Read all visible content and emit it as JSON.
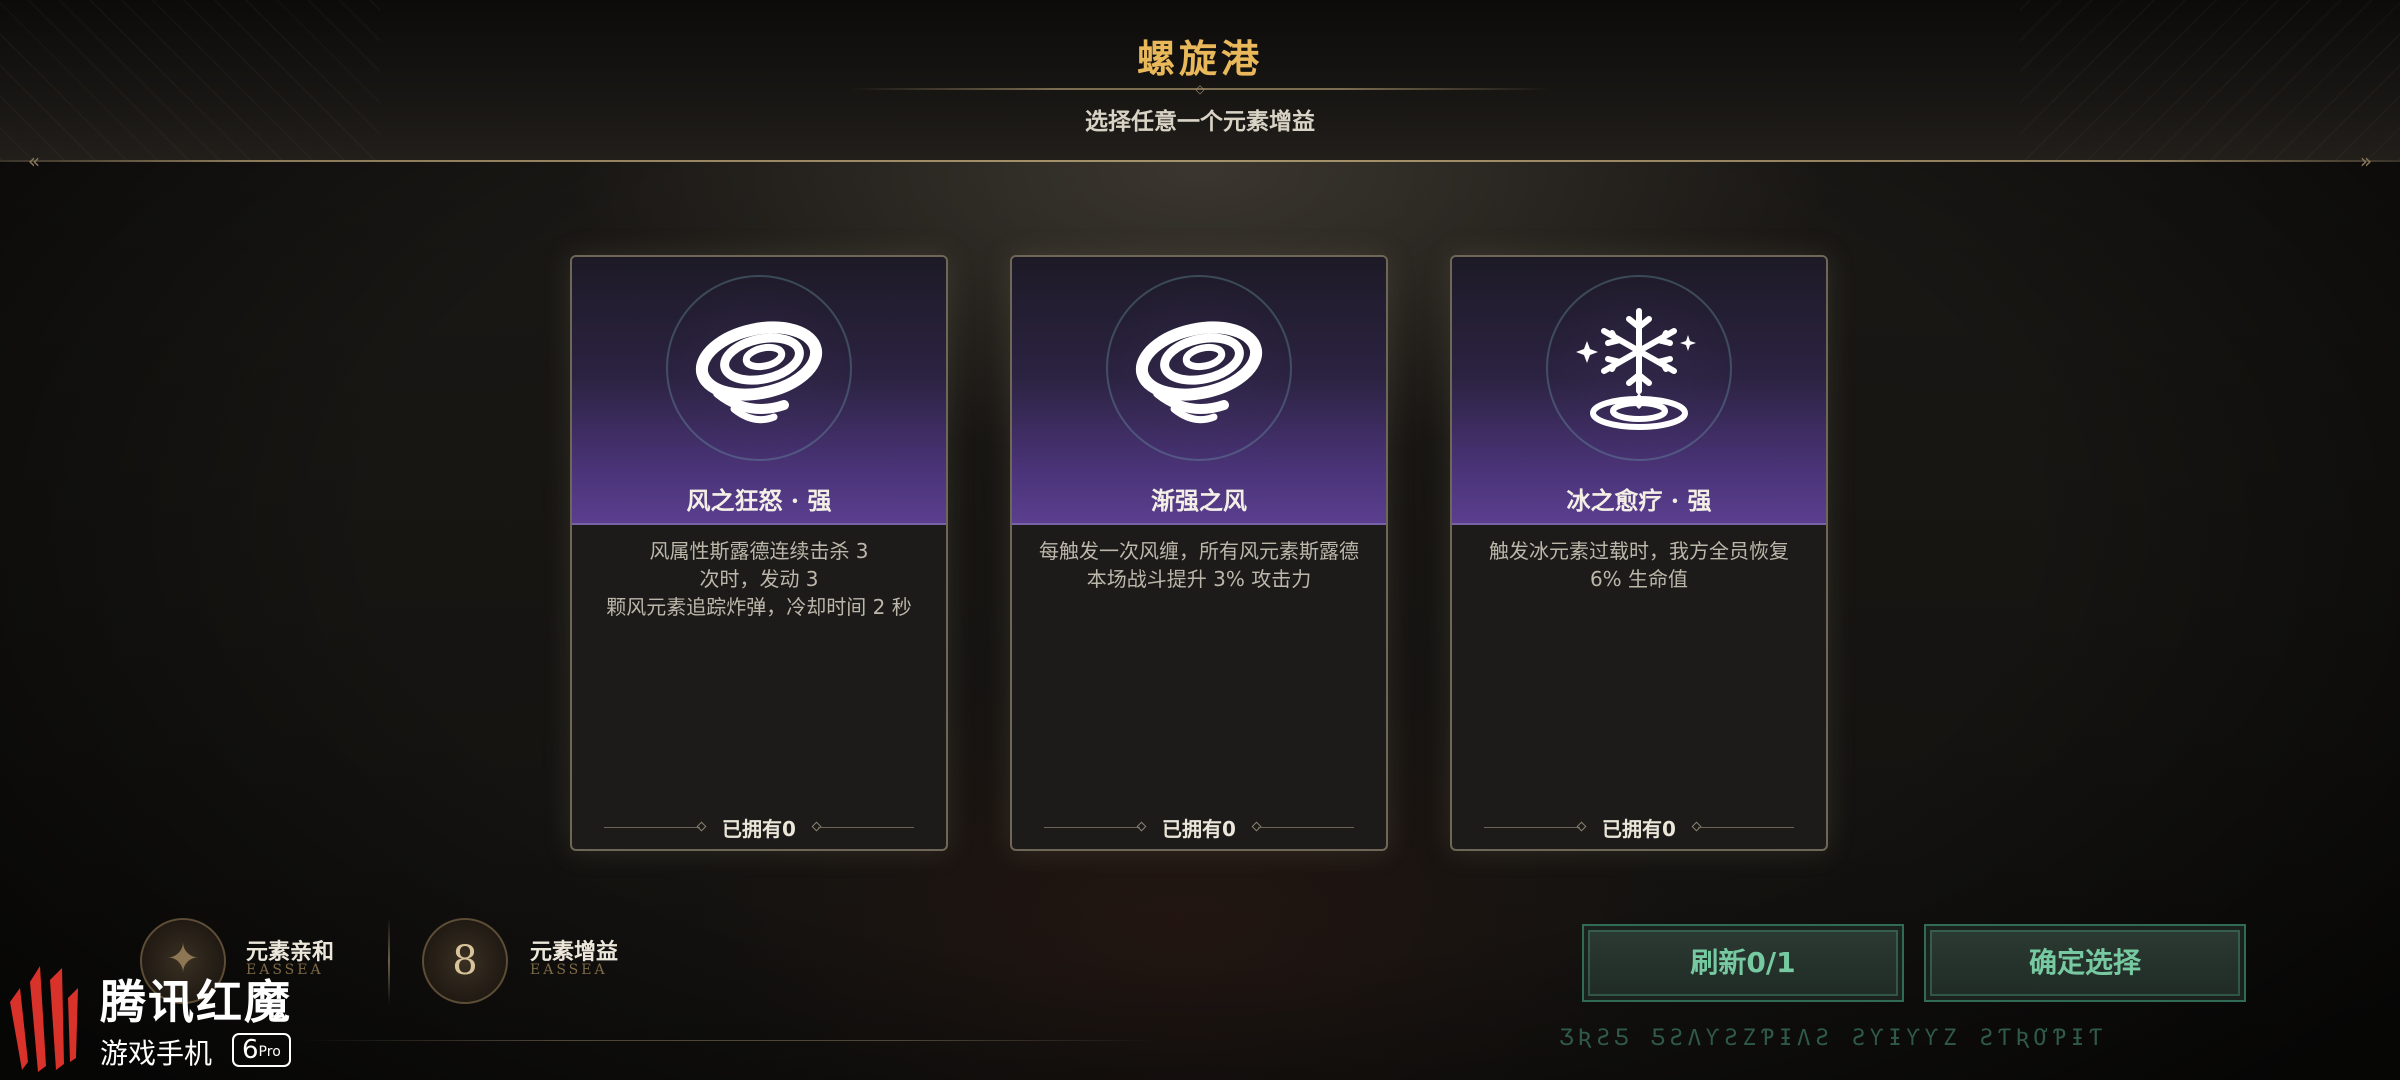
{
  "header": {
    "title": "螺旋港",
    "subtitle": "选择任意一个元素增益"
  },
  "cards": [
    {
      "name": "风之狂怒 · 强",
      "icon": "wind-vortex-icon",
      "description": "风属性斯露德连续击杀 3\n次时，发动 3\n颗风元素追踪炸弹，冷却时间 2 秒",
      "owned": "已拥有0"
    },
    {
      "name": "渐强之风",
      "icon": "wind-vortex-icon",
      "description": "每触发一次风缠，所有风元素斯露德\n本场战斗提升 3% 攻击力",
      "owned": "已拥有0"
    },
    {
      "name": "冰之愈疗 · 强",
      "icon": "snowflake-heal-icon",
      "description": "触发冰元素过载时，我方全员恢复\n6% 生命值",
      "owned": "已拥有0"
    }
  ],
  "bottom": {
    "affinity_label": "元素亲和",
    "affinity_sub": "EASSEA",
    "boost_label": "元素增益",
    "boost_sub": "EASSEA",
    "boost_count": "8"
  },
  "buttons": {
    "refresh": "刷新0/1",
    "confirm": "确定选择"
  },
  "runes": "ƷƦƧƼ ƼƧΛƳƧZƤƗΛƧ ƧƳƗƳƳZ ƧƬƦƠƤƗƬ",
  "watermark": {
    "brand": "腾讯红魔",
    "sub": "游戏手机",
    "badge_num": "6",
    "badge_suffix": "Pro"
  },
  "colors": {
    "title_gold": "#e9b85a",
    "card_purple": "#5b3f8f",
    "button_green": "#76c9a1",
    "watermark_red": "#d9322a"
  }
}
